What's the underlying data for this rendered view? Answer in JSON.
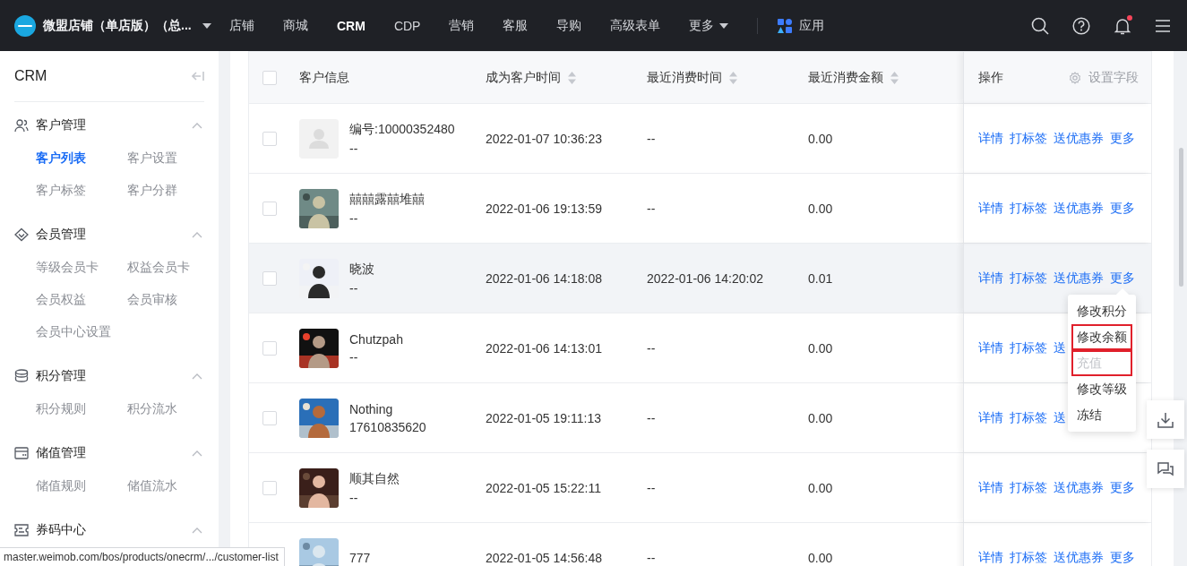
{
  "top_nav": {
    "store_name": "微盟店铺（单店版）（总...",
    "notification_dot": true,
    "items": [
      {
        "label": "店铺",
        "kind": "link",
        "selected": false
      },
      {
        "label": "商城",
        "kind": "link",
        "selected": false
      },
      {
        "label": "CRM",
        "kind": "link",
        "selected": true
      },
      {
        "label": "CDP",
        "kind": "link",
        "selected": false
      },
      {
        "label": "营销",
        "kind": "link",
        "selected": false
      },
      {
        "label": "客服",
        "kind": "link",
        "selected": false
      },
      {
        "label": "导购",
        "kind": "link",
        "selected": false
      },
      {
        "label": "高级表单",
        "kind": "link",
        "selected": false
      },
      {
        "label": "更多",
        "kind": "dropdown",
        "selected": false
      },
      {
        "label": "应用",
        "kind": "apps",
        "selected": false
      }
    ]
  },
  "sidebar": {
    "title": "CRM",
    "groups": [
      {
        "label": "客户管理",
        "expanded": true,
        "items": [
          {
            "label": "客户列表",
            "selected": true
          },
          {
            "label": "客户设置",
            "selected": false
          },
          {
            "label": "客户标签",
            "selected": false
          },
          {
            "label": "客户分群",
            "selected": false
          }
        ]
      },
      {
        "label": "会员管理",
        "expanded": true,
        "items": [
          {
            "label": "等级会员卡",
            "selected": false
          },
          {
            "label": "权益会员卡",
            "selected": false
          },
          {
            "label": "会员权益",
            "selected": false
          },
          {
            "label": "会员审核",
            "selected": false
          },
          {
            "label": "会员中心设置",
            "selected": false
          }
        ]
      },
      {
        "label": "积分管理",
        "expanded": true,
        "items": [
          {
            "label": "积分规则",
            "selected": false
          },
          {
            "label": "积分流水",
            "selected": false
          }
        ]
      },
      {
        "label": "储值管理",
        "expanded": true,
        "items": [
          {
            "label": "储值规则",
            "selected": false
          },
          {
            "label": "储值流水",
            "selected": false
          }
        ]
      },
      {
        "label": "券码中心",
        "expanded": true
      }
    ]
  },
  "table": {
    "select_all_checked": false,
    "columns": [
      {
        "label": "客户信息",
        "sortable": false
      },
      {
        "label": "成为客户时间",
        "sortable": true
      },
      {
        "label": "最近消费时间",
        "sortable": true
      },
      {
        "label": "最近消费金额",
        "sortable": true
      }
    ],
    "ops_column": {
      "label": "操作",
      "settings": "设置字段"
    },
    "rows": [
      {
        "checked": false,
        "hovered": false,
        "kind": "placeholder",
        "name": "编号:10000352480",
        "sub": "--",
        "joined": "2022-01-07 10:36:23",
        "last_purchase": "--",
        "amount": "0.00",
        "actions": [
          "详情",
          "打标签",
          "送优惠券",
          "更多"
        ]
      },
      {
        "checked": false,
        "hovered": false,
        "kind": "picture",
        "name": "囍囍露囍堆囍",
        "sub": "--",
        "joined": "2022-01-06 19:13:59",
        "last_purchase": "--",
        "amount": "0.00",
        "actions": [
          "详情",
          "打标签",
          "送优惠券",
          "更多"
        ]
      },
      {
        "checked": false,
        "hovered": true,
        "kind": "picture",
        "name": "晓波",
        "sub": "--",
        "joined": "2022-01-06 14:18:08",
        "last_purchase": "2022-01-06 14:20:02",
        "amount": "0.01",
        "actions": [
          "详情",
          "打标签",
          "送优惠券",
          "更多"
        ],
        "menu": [
          {
            "label": "修改积分",
            "disabled": false,
            "highlighted": false
          },
          {
            "label": "修改余额",
            "disabled": false,
            "highlighted": true
          },
          {
            "label": "充值",
            "disabled": true,
            "highlighted": true
          },
          {
            "label": "修改等级",
            "disabled": false,
            "highlighted": false
          },
          {
            "label": "冻结",
            "disabled": false,
            "highlighted": false
          }
        ]
      },
      {
        "checked": false,
        "hovered": false,
        "kind": "picture",
        "name": "Chutzpah",
        "sub": "--",
        "joined": "2022-01-06 14:13:01",
        "last_purchase": "--",
        "amount": "0.00",
        "actions": [
          "详情",
          "打标签",
          "送"
        ]
      },
      {
        "checked": false,
        "hovered": false,
        "kind": "picture",
        "name": "Nothing",
        "sub": "17610835620",
        "joined": "2022-01-05 19:11:13",
        "last_purchase": "--",
        "amount": "0.00",
        "actions": [
          "详情",
          "打标签",
          "送"
        ]
      },
      {
        "checked": false,
        "hovered": false,
        "kind": "picture",
        "name": "顺其自然",
        "sub": "--",
        "joined": "2022-01-05 15:22:11",
        "last_purchase": "--",
        "amount": "0.00",
        "actions": [
          "详情",
          "打标签",
          "送优惠券",
          "更多"
        ]
      },
      {
        "hovered": false,
        "kind": "picture",
        "name": "777",
        "joined": "2022-01-05 14:56:48",
        "last_purchase": "--",
        "amount": "0.00",
        "actions": [
          "详情",
          "打标签",
          "送优惠券",
          "更多"
        ]
      }
    ]
  },
  "status_url": "master.weimob.com/bos/products/onecrm/.../customer-list"
}
